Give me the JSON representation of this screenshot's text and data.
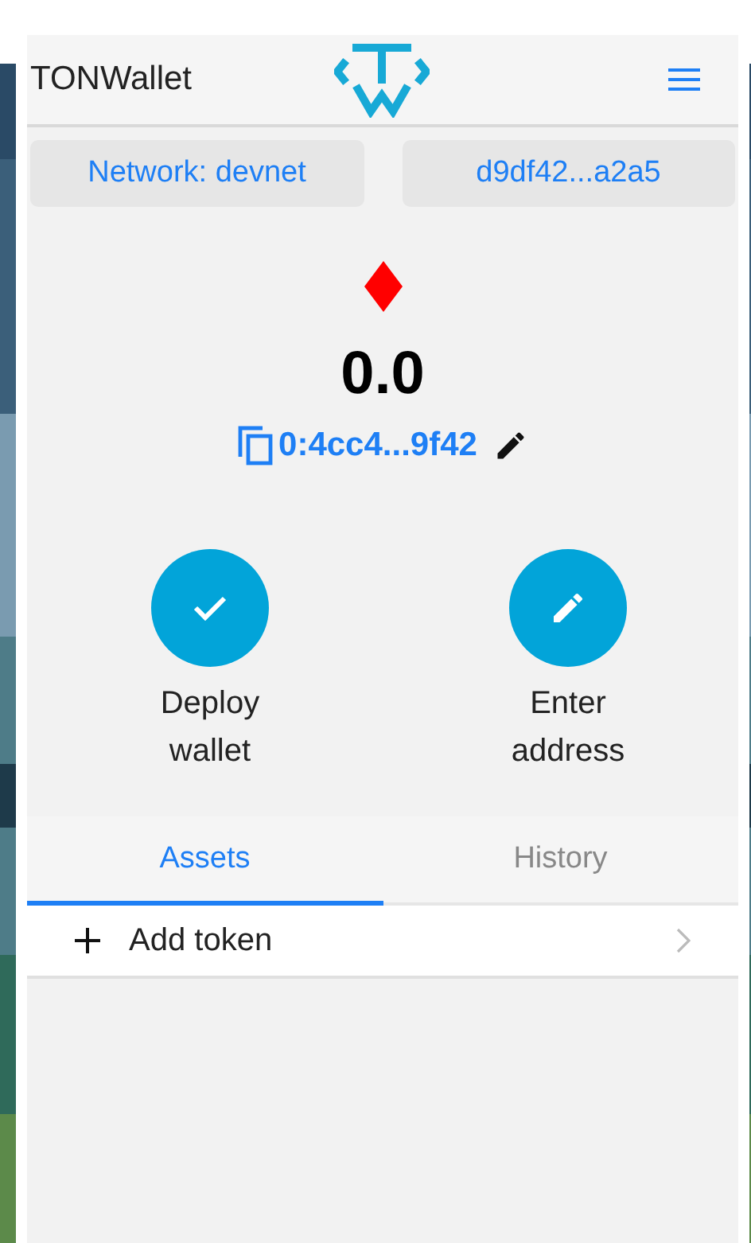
{
  "header": {
    "title": "TONWallet"
  },
  "top_buttons": [
    {
      "label": "Network: devnet"
    },
    {
      "label": "d9df42...a2a5"
    }
  ],
  "balance": {
    "amount": "0.0",
    "address": "0:4cc4...9f42"
  },
  "actions": [
    {
      "kind": "deploy",
      "label": "Deploy wallet"
    },
    {
      "kind": "edit",
      "label": "Enter address"
    }
  ],
  "tabs": [
    {
      "label": "Assets",
      "selected": true
    },
    {
      "label": "History",
      "selected": false
    }
  ],
  "assets": [
    {
      "label": "Add token"
    }
  ]
}
